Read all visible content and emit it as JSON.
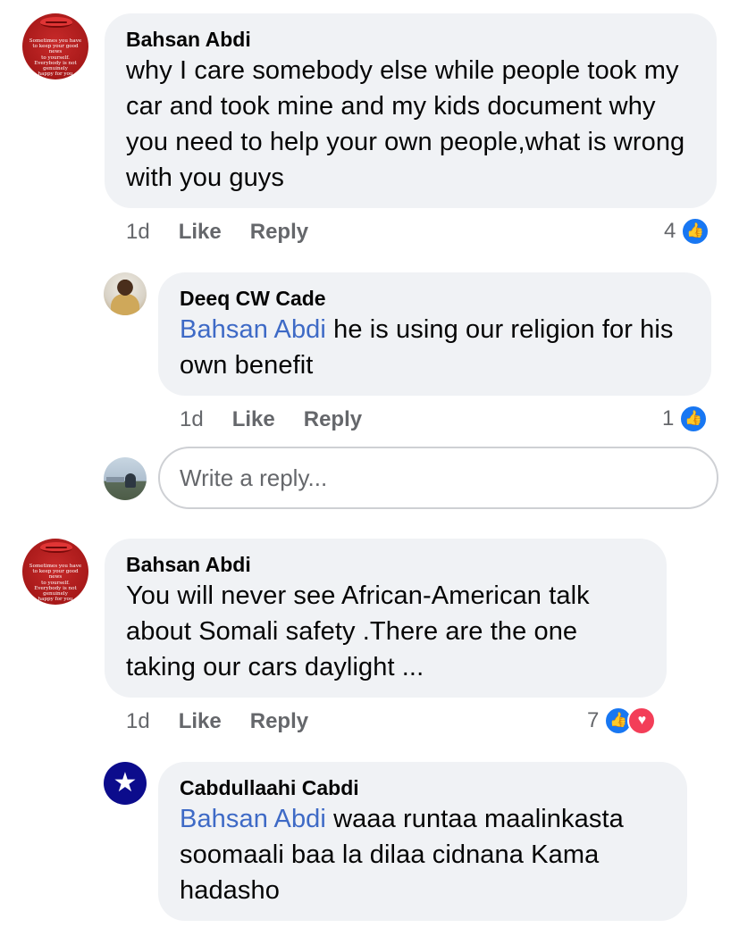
{
  "comments": [
    {
      "author": "Bahsan Abdi",
      "avatar_text": "Sometimes you have\nto keep your good news\nto yourself.\nEverybody is not\ngenuinely\nhappy for you",
      "text": "why I care somebody else while people took my car and took mine and my kids document why you need to help your own people,what  is wrong with you guys",
      "time": "1d",
      "like_label": "Like",
      "reply_label": "Reply",
      "reaction_count": "4",
      "reactions": [
        "like-icon"
      ],
      "replies": [
        {
          "author": "Deeq CW Cade",
          "mention": "Bahsan Abdi",
          "text": " he is using our religion for his own benefit",
          "time": "1d",
          "like_label": "Like",
          "reply_label": "Reply",
          "reaction_count": "1",
          "reactions": [
            "like-icon"
          ]
        }
      ]
    },
    {
      "author": "Bahsan Abdi",
      "avatar_text": "Sometimes you have\nto keep your good news\nto yourself.\nEverybody is not\ngenuinely\nhappy for you",
      "text": "You will never see African-American talk about Somali  safety .There are the one taking our cars  daylight ...",
      "time": "1d",
      "like_label": "Like",
      "reply_label": "Reply",
      "reaction_count": "7",
      "reactions": [
        "like-icon",
        "heart-icon"
      ],
      "replies": [
        {
          "author": "Cabdullaahi Cabdi",
          "mention": "Bahsan Abdi",
          "text": " waaa runtaa maalinkasta soomaali baa la dilaa cidnana Kama hadasho"
        }
      ]
    }
  ],
  "reply_box": {
    "placeholder": "Write a reply..."
  },
  "colors": {
    "bubble": "#f0f2f5",
    "mention": "#3e6ac6",
    "like_blue": "#1877f2",
    "love_red": "#f33e58",
    "meta_gray": "#65676b"
  }
}
